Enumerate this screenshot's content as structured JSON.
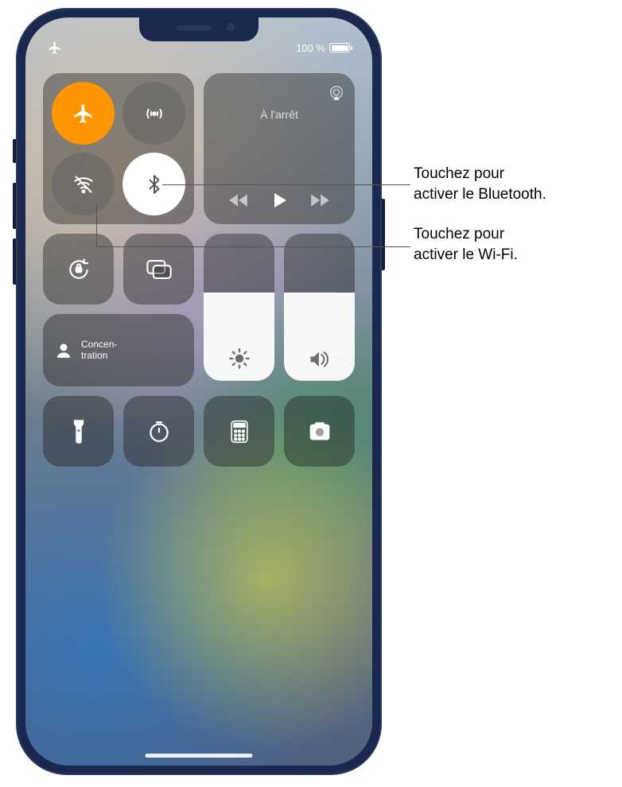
{
  "status_bar": {
    "battery_text": "100 %"
  },
  "connectivity": {
    "airplane": {
      "state": "on"
    },
    "cellular": {
      "state": "off"
    },
    "wifi": {
      "state": "off"
    },
    "bluetooth": {
      "state": "on_white"
    }
  },
  "media": {
    "title": "À l'arrêt"
  },
  "focus": {
    "label": "Concen-\ntration"
  },
  "sliders": {
    "brightness_percent": 60,
    "volume_percent": 60
  },
  "callouts": {
    "bluetooth": "Touchez pour\nactiver le Bluetooth.",
    "wifi": "Touchez pour\nactiver le Wi-Fi."
  }
}
